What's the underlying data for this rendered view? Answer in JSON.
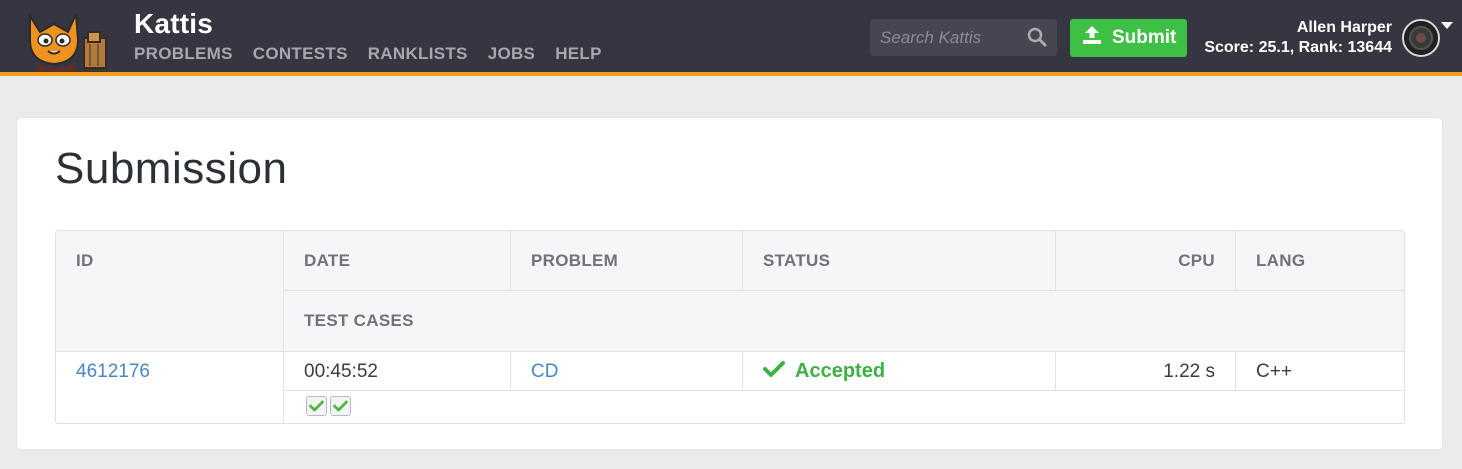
{
  "header": {
    "brand": "Kattis",
    "nav": [
      "PROBLEMS",
      "CONTESTS",
      "RANKLISTS",
      "JOBS",
      "HELP"
    ],
    "search_placeholder": "Search Kattis",
    "submit_label": "Submit",
    "user_name": "Allen Harper",
    "user_score": "Score: 25.1, Rank: 13644",
    "accent_color": "#f2a01b",
    "submit_color": "#3ec045"
  },
  "page": {
    "title": "Submission"
  },
  "table": {
    "headers": {
      "id": "ID",
      "date": "DATE",
      "problem": "PROBLEM",
      "status": "STATUS",
      "cpu": "CPU",
      "lang": "LANG",
      "test_cases": "TEST CASES"
    },
    "row": {
      "id": "4612176",
      "date": "00:45:52",
      "problem": "CD",
      "status": "Accepted",
      "cpu": "1.22 s",
      "lang": "C++",
      "test_case_results": [
        "passed",
        "passed"
      ]
    },
    "status_color": "#3db243",
    "link_color": "#4a86c5"
  },
  "icons": {
    "search": "search-icon",
    "submit": "upload-icon",
    "accepted": "checkmark-icon",
    "caret": "caret-down-icon"
  }
}
